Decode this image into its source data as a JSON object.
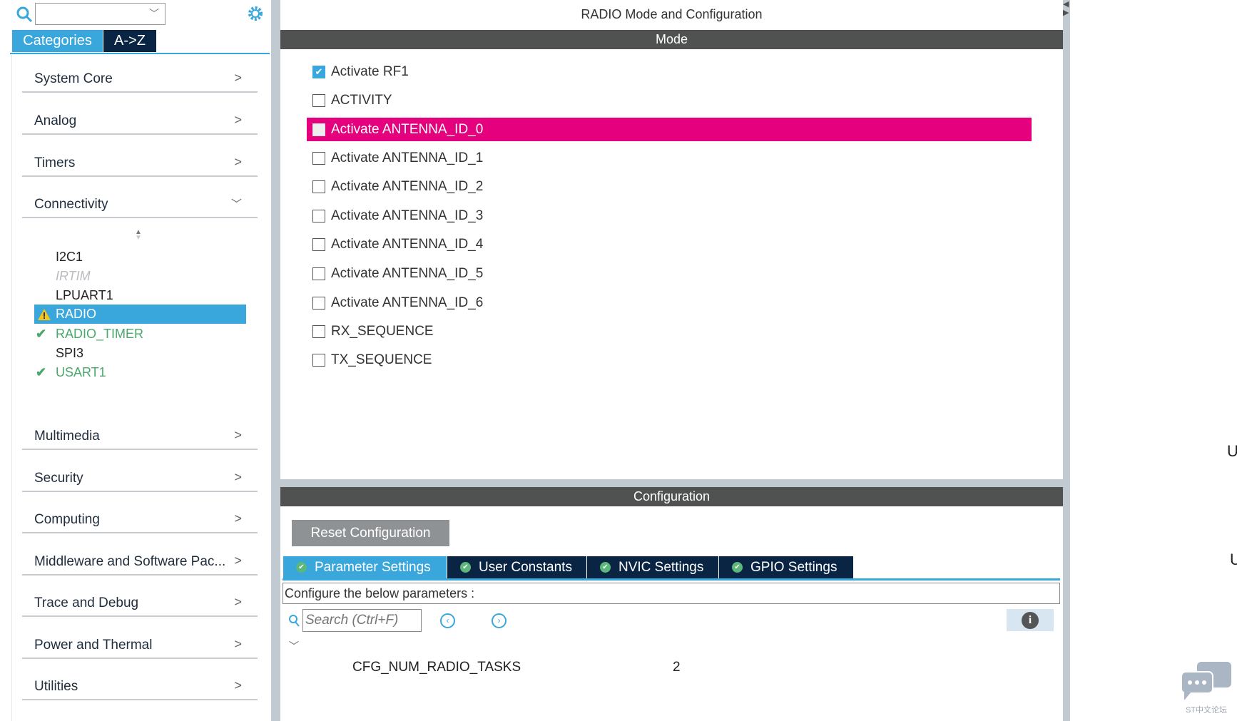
{
  "sidebar": {
    "search_value": "",
    "tabs": [
      {
        "label": "Categories",
        "active": true
      },
      {
        "label": "A->Z",
        "active": false
      }
    ],
    "categories_top": [
      "System Core",
      "Analog",
      "Timers",
      "Connectivity"
    ],
    "connectivity_items": [
      {
        "label": "I2C1",
        "status": "none"
      },
      {
        "label": "IRTIM",
        "status": "disabled"
      },
      {
        "label": "LPUART1",
        "status": "none"
      },
      {
        "label": "RADIO",
        "status": "warning",
        "selected": true
      },
      {
        "label": "RADIO_TIMER",
        "status": "ok"
      },
      {
        "label": "SPI3",
        "status": "none"
      },
      {
        "label": "USART1",
        "status": "ok"
      }
    ],
    "categories_bottom": [
      "Multimedia",
      "Security",
      "Computing",
      "Middleware and Software Pac...",
      "Trace and Debug",
      "Power and Thermal",
      "Utilities"
    ]
  },
  "main": {
    "title": "RADIO Mode and Configuration",
    "mode_header": "Mode",
    "mode_options": [
      {
        "label": "Activate RF1",
        "checked": true
      },
      {
        "label": "ACTIVITY",
        "checked": false
      },
      {
        "label": "Activate ANTENNA_ID_0",
        "checked": false,
        "highlighted": true
      },
      {
        "label": "Activate ANTENNA_ID_1",
        "checked": false
      },
      {
        "label": "Activate ANTENNA_ID_2",
        "checked": false
      },
      {
        "label": "Activate ANTENNA_ID_3",
        "checked": false
      },
      {
        "label": "Activate ANTENNA_ID_4",
        "checked": false
      },
      {
        "label": "Activate ANTENNA_ID_5",
        "checked": false
      },
      {
        "label": "Activate ANTENNA_ID_6",
        "checked": false
      },
      {
        "label": "RX_SEQUENCE",
        "checked": false
      },
      {
        "label": "TX_SEQUENCE",
        "checked": false
      }
    ],
    "config_header": "Configuration",
    "reset_label": "Reset Configuration",
    "config_tabs": [
      "Parameter Settings",
      "User Constants",
      "NVIC Settings",
      "GPIO Settings"
    ],
    "configure_text": "Configure the below parameters :",
    "search_placeholder": "Search (Ctrl+F)",
    "params": [
      {
        "name": "CFG_NUM_RADIO_TASKS",
        "value": "2"
      }
    ]
  },
  "right": {
    "chars": [
      "U",
      "U"
    ],
    "watermark": "ST中文论坛"
  },
  "colors": {
    "accent": "#39a6dc",
    "highlight": "#e5007e",
    "dark_tab": "#0a2444",
    "ok": "#4aa86a"
  }
}
